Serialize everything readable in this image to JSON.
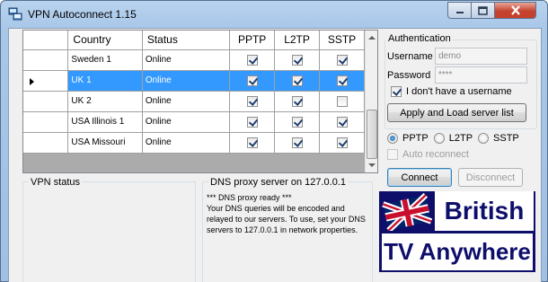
{
  "window": {
    "title": "VPN Autoconnect 1.15"
  },
  "grid": {
    "columns": [
      "Country",
      "Status",
      "PPTP",
      "L2TP",
      "SSTP"
    ],
    "rows": [
      {
        "country": "Sweden 1",
        "status": "Online",
        "pptp": true,
        "l2tp": true,
        "sstp": true,
        "selected": false
      },
      {
        "country": "UK 1",
        "status": "Online",
        "pptp": true,
        "l2tp": true,
        "sstp": true,
        "selected": true
      },
      {
        "country": "UK 2",
        "status": "Online",
        "pptp": true,
        "l2tp": true,
        "sstp": false,
        "selected": false
      },
      {
        "country": "USA Illinois 1",
        "status": "Online",
        "pptp": true,
        "l2tp": true,
        "sstp": true,
        "selected": false
      },
      {
        "country": "USA Missouri",
        "status": "Online",
        "pptp": true,
        "l2tp": true,
        "sstp": true,
        "selected": false
      }
    ]
  },
  "auth": {
    "title": "Authentication",
    "username_label": "Username",
    "username_value": "demo",
    "password_label": "Password",
    "password_value": "****",
    "no_username_label": "I don't have a username",
    "no_username_checked": true,
    "apply_label": "Apply and Load server list"
  },
  "protocols": {
    "options": [
      "PPTP",
      "L2TP",
      "SSTP"
    ],
    "selected": "PPTP",
    "auto_reconnect_label": "Auto reconnect",
    "auto_reconnect_checked": false
  },
  "actions": {
    "connect_label": "Connect",
    "disconnect_label": "Disconnect"
  },
  "vpn_status": {
    "title": "VPN status"
  },
  "dns": {
    "title": "DNS proxy server on 127.0.0.1",
    "log": "*** DNS proxy ready ***\nYour DNS queries will be encoded and relayed to our servers. To use, set your DNS servers to 127.0.0.1 in network properties."
  },
  "banner": {
    "line1": "British",
    "line2": "TV Anywhere"
  },
  "colors": {
    "selection": "#3399ff",
    "banner_bg": "#0e0e6b"
  }
}
